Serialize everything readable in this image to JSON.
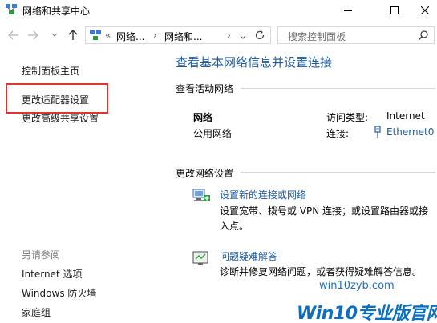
{
  "window": {
    "title": "网络和共享中心"
  },
  "address_bar": {
    "overflow": "«",
    "crumb1": "网络...",
    "sep1": "›",
    "crumb2": "网络和...",
    "sep2": "›"
  },
  "search": {
    "placeholder": "搜索控制面板"
  },
  "left_pane": {
    "home": "控制面板主页",
    "change_adapter": "更改适配器设置",
    "change_sharing": "更改高级共享设置",
    "see_also": "另请参阅",
    "internet_options": "Internet 选项",
    "firewall": "Windows 防火墙",
    "homegroup": "家庭组"
  },
  "main": {
    "title": "查看基本网络信息并设置连接",
    "active_networks_label": "查看活动网络",
    "network_name": "网络",
    "network_type": "公用网络",
    "access_type_label": "访问类型:",
    "access_type_value": "Internet",
    "connections_label": "连接:",
    "connections_value": "Ethernet0",
    "change_settings_label": "更改网络设置",
    "setup_link": "设置新的连接或网络",
    "setup_desc": "设置宽带、拨号或 VPN 连接；或设置路由器或接入点。",
    "troubleshoot_link": "问题疑难解答",
    "troubleshoot_desc": "诊断并修复网络问题，或者获得疑难解答信息。"
  },
  "watermark": {
    "site": "win10zyb.com",
    "brand": "Win10专业版官网"
  },
  "colors": {
    "link": "#1f5aa0",
    "highlight": "#e0352d"
  }
}
